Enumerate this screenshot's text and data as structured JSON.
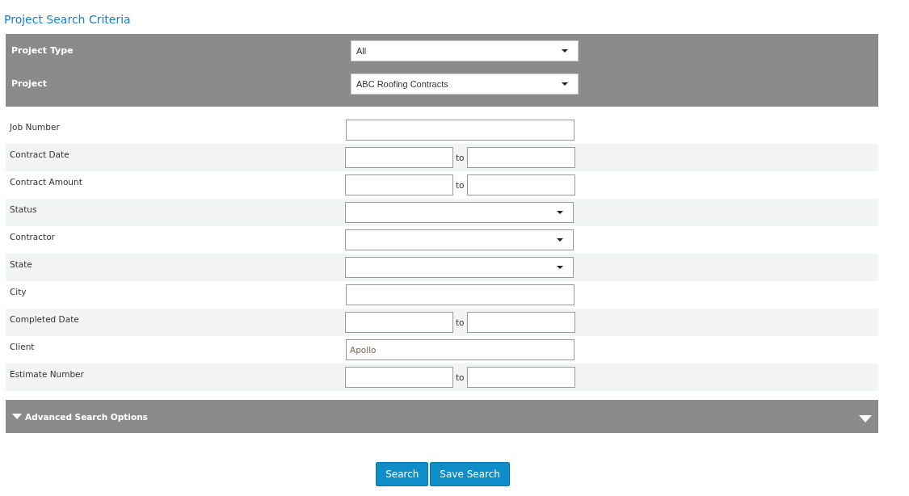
{
  "title": "Project Search Criteria",
  "header_fields": [
    {
      "label": "Project Type",
      "value": "All"
    },
    {
      "label": "Project",
      "value": "ABC Roofing Contracts"
    }
  ],
  "fields": [
    {
      "label": "Job Number",
      "kind": "text"
    },
    {
      "label": "Contract Date",
      "kind": "range",
      "separator": "to"
    },
    {
      "label": "Contract Amount",
      "kind": "range",
      "separator": "to"
    },
    {
      "label": "Status",
      "kind": "select"
    },
    {
      "label": "Contractor",
      "kind": "select"
    },
    {
      "label": "State",
      "kind": "select"
    },
    {
      "label": "City",
      "kind": "text"
    },
    {
      "label": "Completed Date",
      "kind": "range",
      "separator": "to"
    },
    {
      "label": "Client",
      "kind": "text",
      "value": "Apollo"
    },
    {
      "label": "Estimate Number",
      "kind": "range",
      "separator": "to"
    }
  ],
  "advanced": {
    "label": "Advanced Search Options",
    "expanded": false
  },
  "buttons": [
    "Search",
    "Save Search"
  ]
}
